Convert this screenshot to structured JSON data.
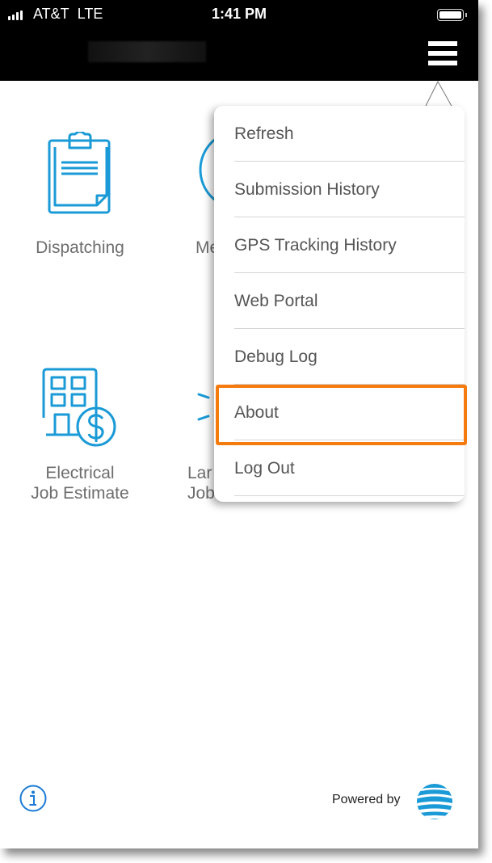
{
  "status_bar": {
    "carrier": "AT&T",
    "network": "LTE",
    "time": "1:41 PM",
    "battery_level": 1.0
  },
  "header": {
    "title_redacted": true,
    "menu_icon": "hamburger-icon"
  },
  "tiles": [
    {
      "label": "Dispatching",
      "icon": "clipboard-icon"
    },
    {
      "label": "Me",
      "icon": "circle-icon",
      "partially_hidden": true
    },
    {
      "label_line1": "Electrical",
      "label_line2": "Job Estimate",
      "icon": "building-dollar-icon"
    },
    {
      "label_line1": "Lar",
      "label_line2": "Job",
      "icon": "rays-icon",
      "partially_hidden": true
    }
  ],
  "menu": {
    "items": [
      {
        "label": "Refresh"
      },
      {
        "label": "Submission History"
      },
      {
        "label": "GPS Tracking History"
      },
      {
        "label": "Web Portal"
      },
      {
        "label": "Debug Log"
      },
      {
        "label": "About",
        "highlighted": true
      },
      {
        "label": "Log Out"
      }
    ],
    "highlight_color": "#f57b0e"
  },
  "footer": {
    "info_icon": "info-icon",
    "powered_by": "Powered by",
    "logo": "att-globe-icon"
  },
  "colors": {
    "accent": "#1a9ad6",
    "header_bg": "#000000",
    "text_gray": "#6d6d6d"
  }
}
